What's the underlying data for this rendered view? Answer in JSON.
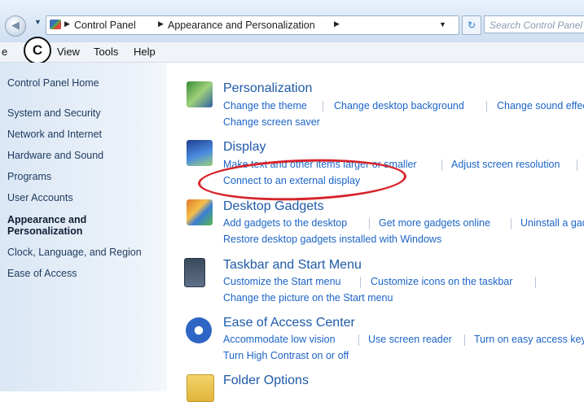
{
  "address_bar": {
    "crumbs": [
      "Control Panel",
      "Appearance and Personalization"
    ],
    "search_placeholder": "Search Control Panel"
  },
  "menu": {
    "items": [
      "e",
      "View",
      "Tools",
      "Help"
    ]
  },
  "callout_label": "C",
  "sidebar": {
    "items": [
      "Control Panel Home",
      "System and Security",
      "Network and Internet",
      "Hardware and Sound",
      "Programs",
      "User Accounts",
      "Appearance and Personalization",
      "Clock, Language, and Region",
      "Ease of Access"
    ],
    "active_label_line1": "Appearance and",
    "active_label_line2": "Personalization"
  },
  "categories": [
    {
      "title": "Personalization",
      "icon": "personalization-icon",
      "links_row1": [
        "Change the theme",
        "Change desktop background",
        "Change sound effects"
      ],
      "links_row2": [
        "Change screen saver"
      ]
    },
    {
      "title": "Display",
      "icon": "display-icon",
      "links_row1": [
        "Make text and other items larger or smaller",
        "Adjust screen resolution"
      ],
      "links_row2": [
        "Connect to an external display"
      ]
    },
    {
      "title": "Desktop Gadgets",
      "icon": "gadgets-icon",
      "links_row1": [
        "Add gadgets to the desktop",
        "Get more gadgets online",
        "Uninstall a gadget"
      ],
      "links_row2": [
        "Restore desktop gadgets installed with Windows"
      ]
    },
    {
      "title": "Taskbar and Start Menu",
      "icon": "taskbar-icon",
      "links_row1": [
        "Customize the Start menu",
        "Customize icons on the taskbar"
      ],
      "links_row2": [
        "Change the picture on the Start menu"
      ]
    },
    {
      "title": "Ease of Access Center",
      "icon": "ease-of-access-icon",
      "links_row1": [
        "Accommodate low vision",
        "Use screen reader",
        "Turn on easy access keys"
      ],
      "links_row2": [
        "Turn High Contrast on or off"
      ]
    },
    {
      "title": "Folder Options",
      "icon": "folder-options-icon",
      "links_row1": [],
      "links_row2": []
    }
  ],
  "colors": {
    "link": "#1c64c6",
    "title": "#1e5aa8",
    "highlight_ellipse": "#d8232a",
    "sidebar_bg": "#dbe7f5"
  }
}
